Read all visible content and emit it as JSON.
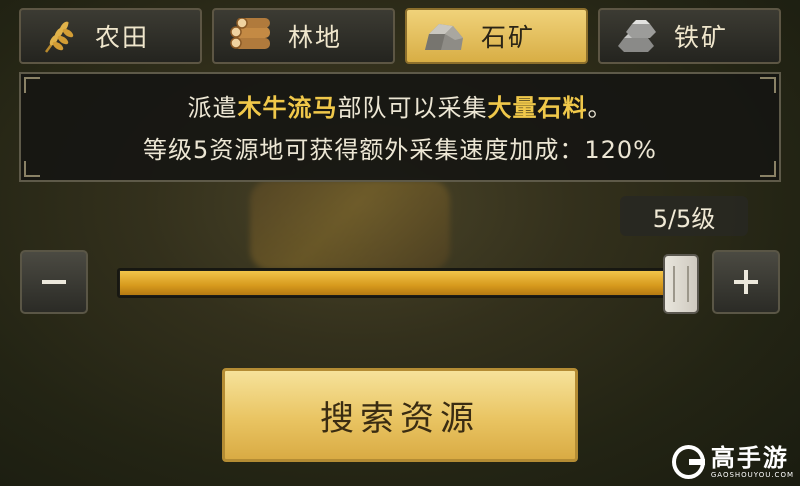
{
  "tabs": [
    {
      "label": "农田",
      "icon": "wheat-icon",
      "active": false
    },
    {
      "label": "林地",
      "icon": "logs-icon",
      "active": false
    },
    {
      "label": "石矿",
      "icon": "stone-icon",
      "active": true
    },
    {
      "label": "铁矿",
      "icon": "iron-ingot-icon",
      "active": false
    }
  ],
  "info": {
    "line1_prefix": "派遣",
    "line1_unit": "木牛流马",
    "line1_middle": "部队可以采集",
    "line1_resource": "大量石料",
    "line1_suffix": "。",
    "line2": "等级5资源地可获得额外采集速度加成：120%"
  },
  "level": {
    "label": "5/5级",
    "current": 5,
    "max": 5
  },
  "slider": {
    "value_fraction": 1.0
  },
  "buttons": {
    "minus_icon": "minus-icon",
    "plus_icon": "plus-icon",
    "search_label": "搜索资源"
  },
  "watermark": {
    "brand": "高手游",
    "domain": "GAOSHOUYOU.COM"
  },
  "colors": {
    "accent_gold": "#f0c84a",
    "active_tab": "#e6c060",
    "slider_fill": "#e0a72a"
  }
}
